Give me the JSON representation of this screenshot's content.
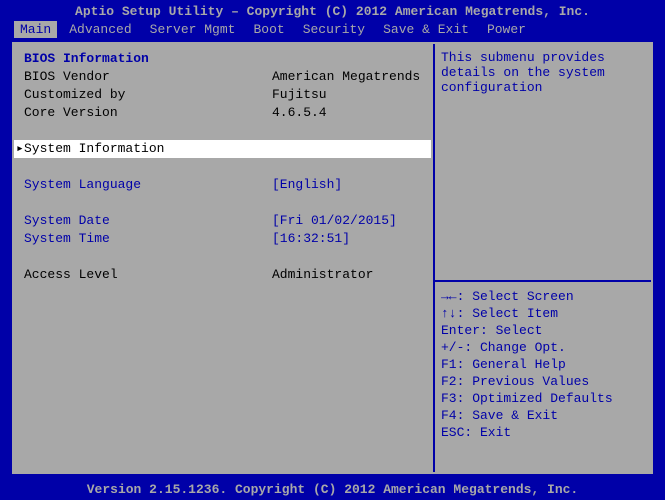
{
  "title": "Aptio Setup Utility – Copyright (C) 2012 American Megatrends, Inc.",
  "footer": "Version 2.15.1236. Copyright (C) 2012 American Megatrends, Inc.",
  "menu": {
    "items": [
      {
        "label": "Main",
        "active": true
      },
      {
        "label": "Advanced",
        "active": false
      },
      {
        "label": "Server Mgmt",
        "active": false
      },
      {
        "label": "Boot",
        "active": false
      },
      {
        "label": "Security",
        "active": false
      },
      {
        "label": "Save & Exit",
        "active": false
      },
      {
        "label": "Power",
        "active": false
      }
    ]
  },
  "main": {
    "section_header": "BIOS Information",
    "rows": [
      {
        "label": "BIOS Vendor",
        "value": "American Megatrends"
      },
      {
        "label": "Customized by",
        "value": "Fujitsu"
      },
      {
        "label": "Core Version",
        "value": "4.6.5.4"
      }
    ],
    "submenu": {
      "label": "System Information",
      "selected": true
    },
    "options": [
      {
        "label": "System Language",
        "value": "[English]"
      }
    ],
    "datetime": [
      {
        "label": "System Date",
        "value": "[Fri 01/02/2015]"
      },
      {
        "label": "System Time",
        "value": "[16:32:51]"
      }
    ],
    "access": {
      "label": "Access Level",
      "value": "Administrator"
    }
  },
  "help": {
    "top": "This submenu provides details on the system configuration",
    "keys": [
      "→←: Select Screen",
      "↑↓: Select Item",
      "Enter: Select",
      "+/-: Change Opt.",
      "F1: General Help",
      "F2: Previous Values",
      "F3: Optimized Defaults",
      "F4: Save & Exit",
      "ESC: Exit"
    ]
  }
}
